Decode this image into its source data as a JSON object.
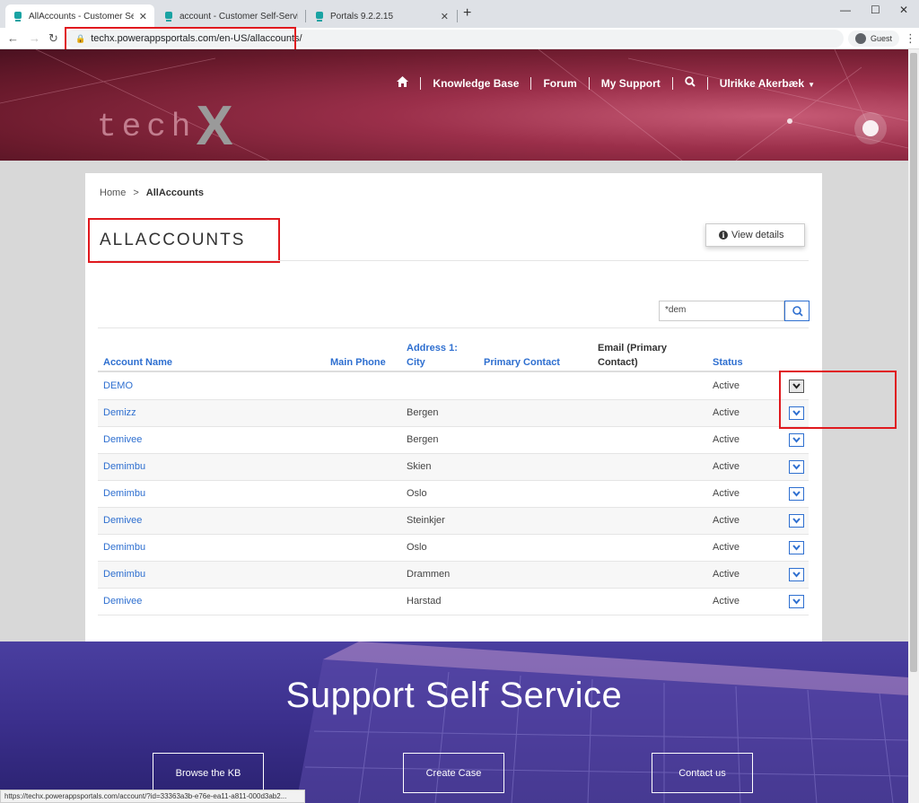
{
  "browser": {
    "tabs": [
      {
        "title": "AllAccounts - Customer Self-Serv",
        "close": "✕"
      },
      {
        "title": "account - Customer Self-Service",
        "close": "✕"
      },
      {
        "title": "Portals 9.2.2.15",
        "close": "✕"
      }
    ],
    "new_tab": "+",
    "url": "techx.powerappsportals.com/en-US/allaccounts/",
    "profile": "Guest",
    "status_url": "https://techx.powerappsportals.com/account/?id=33363a3b-e76e-ea11-a811-000d3ab2..."
  },
  "header": {
    "logo_tech": "tech",
    "logo_x": "X",
    "nav": {
      "knowledge_base": "Knowledge Base",
      "forum": "Forum",
      "my_support": "My Support",
      "user": "Ulrikke Akerbæk"
    }
  },
  "breadcrumb": {
    "home": "Home",
    "separator": ">",
    "current": "AllAccounts"
  },
  "page_title": "ALLACCOUNTS",
  "search": {
    "value": "*dem"
  },
  "table": {
    "headers": {
      "account_name": "Account Name",
      "main_phone": "Main Phone",
      "address_1": "Address 1:",
      "address_2": "City",
      "primary_contact": "Primary Contact",
      "email_1": "Email (Primary",
      "email_2": "Contact)",
      "status": "Status"
    },
    "rows": [
      {
        "name": "DEMO",
        "city": "",
        "status": "Active"
      },
      {
        "name": "Demizz",
        "city": "Bergen",
        "status": "Active"
      },
      {
        "name": "Demivee",
        "city": "Bergen",
        "status": "Active"
      },
      {
        "name": "Demimbu",
        "city": "Skien",
        "status": "Active"
      },
      {
        "name": "Demimbu",
        "city": "Oslo",
        "status": "Active"
      },
      {
        "name": "Demivee",
        "city": "Steinkjer",
        "status": "Active"
      },
      {
        "name": "Demimbu",
        "city": "Oslo",
        "status": "Active"
      },
      {
        "name": "Demimbu",
        "city": "Drammen",
        "status": "Active"
      },
      {
        "name": "Demivee",
        "city": "Harstad",
        "status": "Active"
      }
    ],
    "action_menu": {
      "view_details": "View details",
      "info_glyph": "i"
    }
  },
  "hero": {
    "title": "Support Self Service",
    "buttons": {
      "browse_kb": "Browse the KB",
      "create_case": "Create Case",
      "contact_us": "Contact us"
    }
  },
  "colors": {
    "link": "#2e6fd0",
    "highlight": "#e0191e",
    "header": "#8e2a44",
    "hero": "#3b2f8c"
  }
}
